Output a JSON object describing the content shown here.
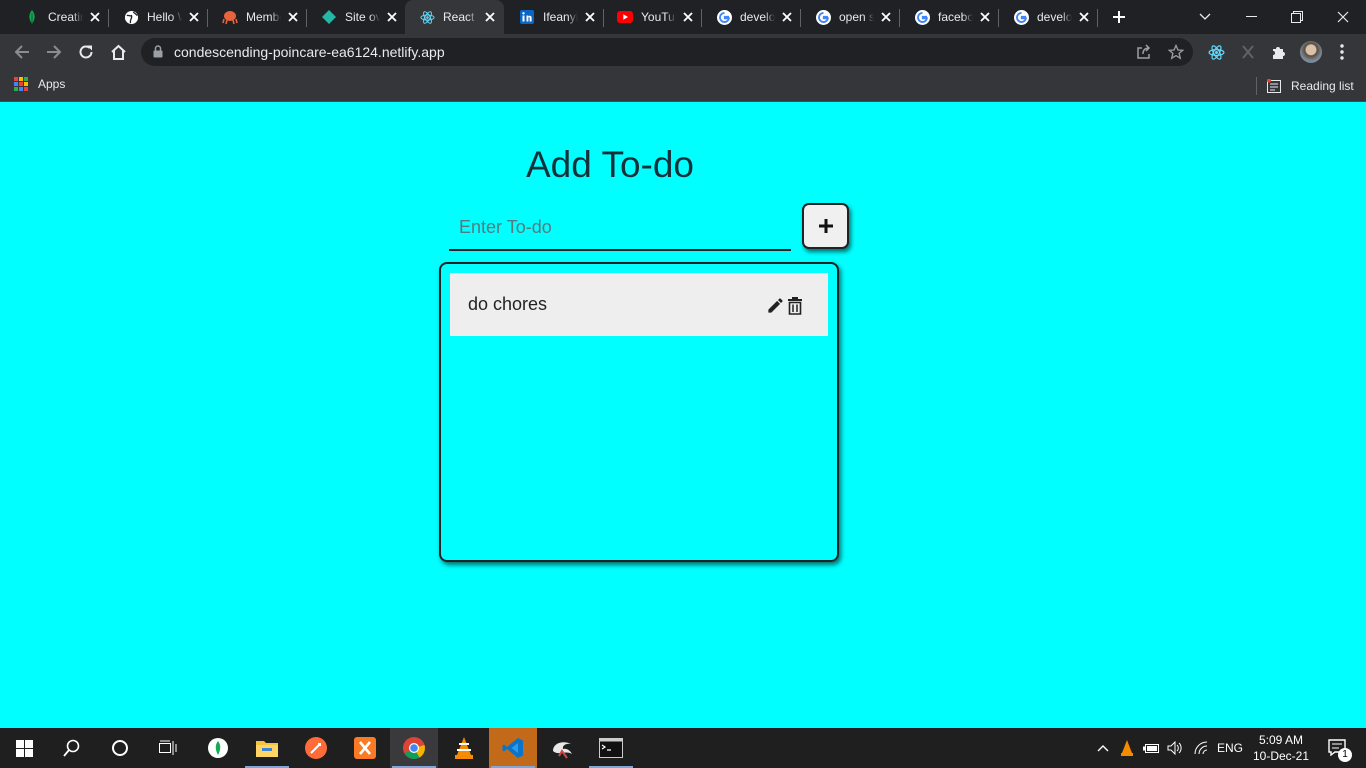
{
  "browser": {
    "tabs": [
      {
        "title": "Creating",
        "favicon": "mongodb-leaf-icon"
      },
      {
        "title": "Hello World",
        "favicon": "globe-icon"
      },
      {
        "title": "Members",
        "favicon": "octopus-icon"
      },
      {
        "title": "Site overview",
        "favicon": "netlify-icon"
      },
      {
        "title": "React App",
        "favicon": "react-icon",
        "active": true
      },
      {
        "title": "Ifeanyi",
        "favicon": "linkedin-icon"
      },
      {
        "title": "YouTube",
        "favicon": "youtube-icon"
      },
      {
        "title": "develop",
        "favicon": "google-icon"
      },
      {
        "title": "open s",
        "favicon": "google-icon"
      },
      {
        "title": "facebook",
        "favicon": "google-icon"
      },
      {
        "title": "develop",
        "favicon": "google-icon"
      }
    ],
    "url": "condescending-poincare-ea6124.netlify.app",
    "bookmarks": {
      "apps_label": "Apps",
      "reading_list_label": "Reading list"
    }
  },
  "app": {
    "title": "Add To-do",
    "input": {
      "placeholder": "Enter To-do",
      "value": ""
    },
    "add_button_icon": "plus-icon",
    "todos": [
      {
        "text": "do chores",
        "actions": [
          "edit-pencil-icon",
          "trash-icon"
        ]
      }
    ],
    "background_color": "#00ffff"
  },
  "taskbar": {
    "apps": [
      "windows-start-icon",
      "search-icon",
      "cortana-icon",
      "task-view-icon",
      "mongodb-compass-icon",
      "file-explorer-icon",
      "postman-icon",
      "xampp-icon",
      "chrome-icon",
      "vlc-icon",
      "vscode-icon",
      "mysql-workbench-icon",
      "terminal-icon"
    ],
    "language": "ENG",
    "time": "5:09 AM",
    "date": "10-Dec-21",
    "notifications_count": "1"
  }
}
